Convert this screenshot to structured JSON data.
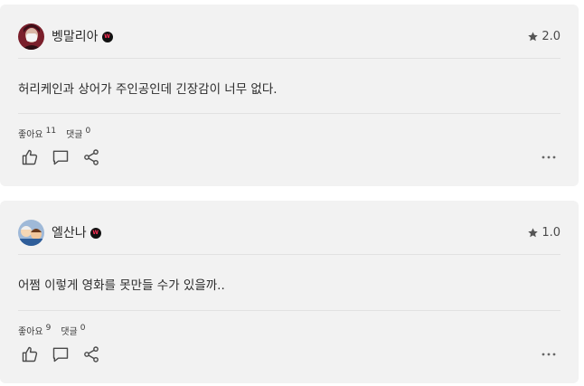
{
  "reviews": [
    {
      "username": "벵말리아",
      "badge_letter": "W",
      "rating": "2.0",
      "text": "허리케인과 상어가 주인공인데 긴장감이 너무 없다.",
      "likes_label": "좋아요",
      "likes_count": "11",
      "comments_label": "댓글",
      "comments_count": "0"
    },
    {
      "username": "엘산나",
      "badge_letter": "W",
      "rating": "1.0",
      "text": "어쩜 이렇게 영화를 못만들 수가 있을까..",
      "likes_label": "좋아요",
      "likes_count": "9",
      "comments_label": "댓글",
      "comments_count": "0"
    }
  ],
  "colors": {
    "card_bg": "#f2f2f2",
    "badge_bg": "#111111",
    "badge_letter": "#ff2d55",
    "icon": "#4a4a4a"
  },
  "icons": [
    "star-icon",
    "thumbs-up-icon",
    "comment-icon",
    "share-icon",
    "more-icon"
  ]
}
